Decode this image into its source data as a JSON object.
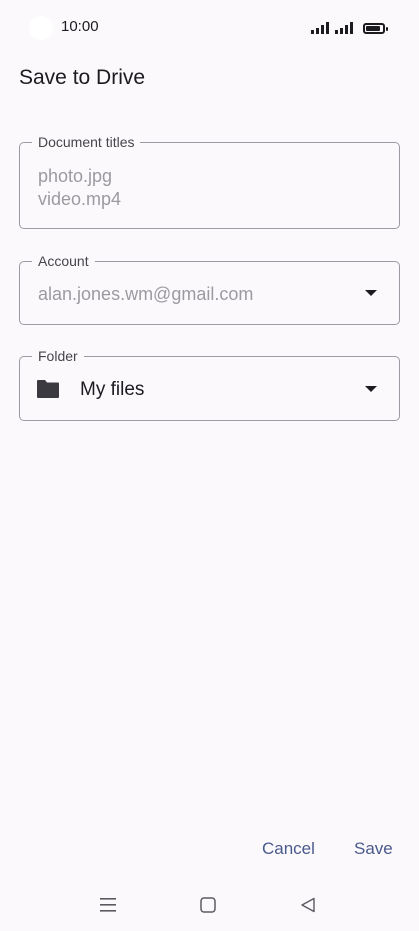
{
  "status_bar": {
    "time": "10:00"
  },
  "header": {
    "title": "Save to Drive"
  },
  "document_titles": {
    "label": "Document titles",
    "items": [
      "photo.jpg",
      "video.mp4"
    ]
  },
  "account": {
    "label": "Account",
    "value": "alan.jones.wm@gmail.com"
  },
  "folder": {
    "label": "Folder",
    "value": "My files",
    "icon": "folder-icon"
  },
  "actions": {
    "cancel_label": "Cancel",
    "save_label": "Save"
  },
  "colors": {
    "background": "#fcf9fd",
    "accent": "#4a5a8a",
    "outline": "#9e9aa3",
    "muted_text": "#9c9aa0"
  }
}
